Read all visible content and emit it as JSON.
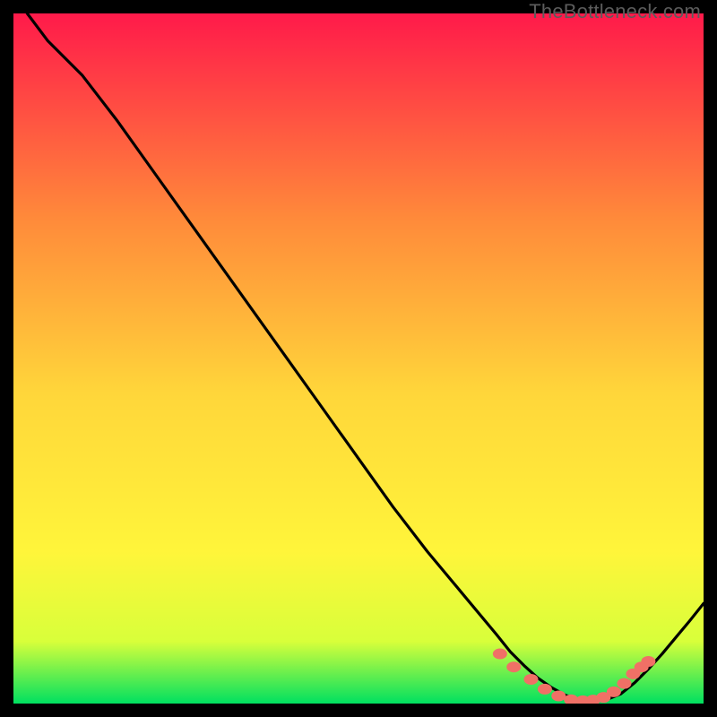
{
  "watermark": "TheBottleneck.com",
  "colors": {
    "gradient_top": "#ff1a4a",
    "gradient_upper_mid": "#ff8b3a",
    "gradient_mid": "#ffd63a",
    "gradient_lower_mid": "#fff53a",
    "gradient_low": "#d8ff3a",
    "gradient_bottom": "#00e060",
    "curve": "#000000",
    "marker": "#f07066",
    "frame": "#000000"
  },
  "chart_data": {
    "type": "line",
    "title": "",
    "xlabel": "",
    "ylabel": "",
    "xlim": [
      0,
      100
    ],
    "ylim": [
      0,
      100
    ],
    "series": [
      {
        "name": "curve",
        "x": [
          2,
          5,
          10,
          15,
          20,
          25,
          30,
          35,
          40,
          45,
          50,
          55,
          60,
          65,
          70,
          72,
          74,
          76,
          78,
          80,
          82,
          84,
          86,
          88,
          90,
          92,
          94,
          96,
          98,
          100
        ],
        "values": [
          100,
          96,
          91,
          84.5,
          77.5,
          70.5,
          63.5,
          56.5,
          49.5,
          42.5,
          35.5,
          28.5,
          22,
          16,
          10,
          7.5,
          5.5,
          3.7,
          2.3,
          1.2,
          0.6,
          0.4,
          0.6,
          1.4,
          3.0,
          5.0,
          7.2,
          9.6,
          12.0,
          14.5
        ]
      }
    ],
    "markers": {
      "name": "dots",
      "x": [
        70.5,
        72.5,
        75,
        77,
        79,
        80.8,
        82.5,
        84,
        85.5,
        87,
        88.5,
        89.8,
        91,
        92
      ],
      "values": [
        7.2,
        5.3,
        3.5,
        2.1,
        1.1,
        0.55,
        0.4,
        0.5,
        0.9,
        1.7,
        2.9,
        4.3,
        5.3,
        6.1
      ]
    }
  }
}
